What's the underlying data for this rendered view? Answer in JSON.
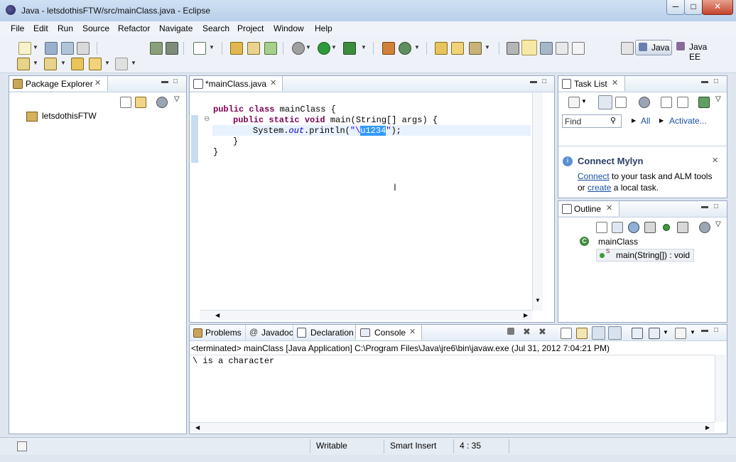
{
  "window": {
    "title": "Java - letsdothisFTW/src/mainClass.java - Eclipse",
    "minimize": "─",
    "maximize": "□",
    "close": "✕"
  },
  "menu": [
    "File",
    "Edit",
    "Run",
    "Source",
    "Refactor",
    "Navigate",
    "Search",
    "Project",
    "Window",
    "Help"
  ],
  "perspectives": {
    "java": "Java",
    "javaee": "Java EE"
  },
  "package_explorer": {
    "title": "Package Explorer",
    "project": "letsdothisFTW"
  },
  "editor": {
    "tab": "*mainClass.java",
    "lines": {
      "l1_kw": "public class",
      "l1_rest": " mainClass {",
      "l2_kw": "public static void",
      "l2_rest": " main(String[] args) {",
      "l3_pre": "System.",
      "l3_out": "out",
      "l3_mid": ".println(",
      "l3_q1": "\"\\",
      "l3_sel": "u1234",
      "l3_q2": "\"",
      "l3_end": ");",
      "l4": "}",
      "l5": "}"
    }
  },
  "task_list": {
    "title": "Task List",
    "find_placeholder": "Find",
    "all": "All",
    "activate": "Activate..."
  },
  "mylyn": {
    "title": "Connect Mylyn",
    "connect": "Connect",
    "line1_rest": " to your task and ALM tools",
    "line2_pre": "or ",
    "create": "create",
    "line2_rest": " a local task."
  },
  "outline": {
    "title": "Outline",
    "class_name": "mainClass",
    "method": "main(String[]) : void",
    "static_marker": "S"
  },
  "bottom_tabs": {
    "problems": "Problems",
    "javadoc": "Javadoc",
    "declaration": "Declaration",
    "console": "Console"
  },
  "console": {
    "header": "<terminated> mainClass [Java Application] C:\\Program Files\\Java\\jre6\\bin\\javaw.exe (Jul 31, 2012 7:04:21 PM)",
    "output": "\\ is a character"
  },
  "status": {
    "writable": "Writable",
    "insert_mode": "Smart Insert",
    "position": "4 : 35"
  },
  "colors": {
    "keyword": "#7f0055",
    "string": "#2a00ff",
    "selection": "#3399ff",
    "current_line": "#e8f2fe"
  }
}
